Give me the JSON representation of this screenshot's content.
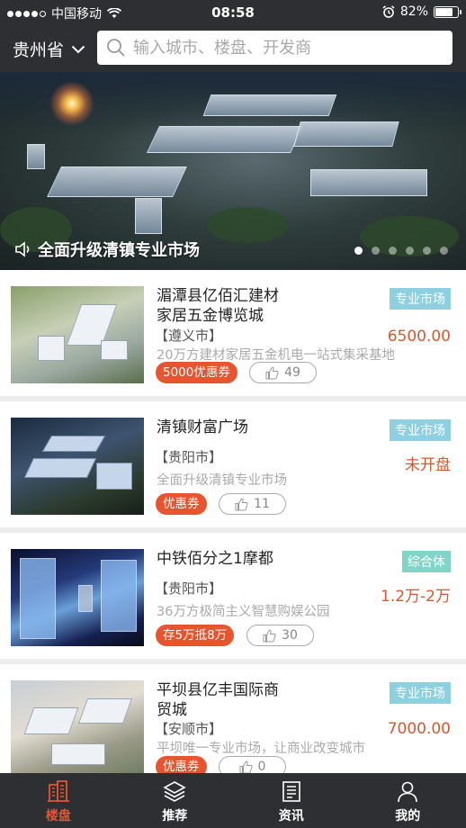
{
  "status_bar": {
    "carrier": "中国移动",
    "time": "08:58",
    "battery": "82%",
    "battery_level": 0.82
  },
  "header": {
    "province": "贵州省",
    "search_placeholder": "输入城市、楼盘、开发商"
  },
  "banner": {
    "caption": "全面升级清镇专业市场",
    "pages": 6,
    "active_page": 1
  },
  "listings": [
    {
      "title_line1": "湄潭县亿佰汇建材",
      "title_line2": "家居五金博览城",
      "tag": "专业市场",
      "price": "6500.00",
      "city": "【遵义市】",
      "desc": "20万方建材家居五金机电一站式集采基地",
      "coupon": "5000优惠券",
      "likes": "49"
    },
    {
      "title_line1": "清镇财富广场",
      "title_line2": "",
      "tag": "专业市场",
      "price": "未开盘",
      "city": "【贵阳市】",
      "desc": "全面升级清镇专业市场",
      "coupon": "优惠券",
      "likes": "11"
    },
    {
      "title_line1": "中铁佰分之1摩都",
      "title_line2": "",
      "tag": "综合体",
      "price": "1.2万-2万",
      "city": "【贵阳市】",
      "desc": "36万方极简主义智慧购娱公园",
      "coupon": "存5万抵8万",
      "likes": "30"
    },
    {
      "title_line1": "平坝县亿丰国际商",
      "title_line2": "贸城",
      "tag": "专业市场",
      "price": "7000.00",
      "city": "【安顺市】",
      "desc": "平坝唯一专业市场，让商业改变城市",
      "coupon": "优惠券",
      "likes": "0"
    }
  ],
  "tabbar": [
    {
      "label": "楼盘",
      "icon": "building-icon",
      "active": true
    },
    {
      "label": "推荐",
      "icon": "layers-icon",
      "active": false
    },
    {
      "label": "资讯",
      "icon": "news-icon",
      "active": false
    },
    {
      "label": "我的",
      "icon": "person-icon",
      "active": false
    }
  ],
  "colors": {
    "dark": "#2e2f33",
    "accent": "#e8542e",
    "tag_blue": "#8fd0e0",
    "tag_teal": "#7fd6c8"
  }
}
